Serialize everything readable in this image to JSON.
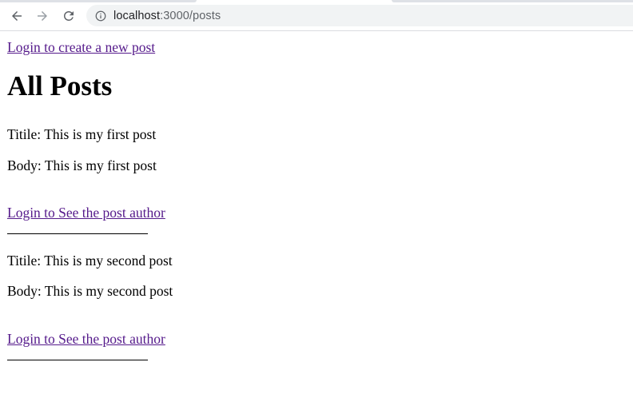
{
  "browser": {
    "url_host": "localhost",
    "url_path": ":3000/posts"
  },
  "page": {
    "create_link": "Login to create a new post",
    "title": "All Posts",
    "posts": [
      {
        "title_line": "Titile: This is my first post",
        "body_line": "Body: This is my first post",
        "author_link": "Login to See the post author"
      },
      {
        "title_line": "Titile: This is my second post",
        "body_line": "Body: This is my second post",
        "author_link": "Login to See the post author"
      }
    ]
  },
  "colors": {
    "visited_link": "#551a8b",
    "omnibox_bg": "#f1f3f4"
  },
  "icons": [
    "back-arrow-icon",
    "forward-arrow-icon",
    "reload-icon",
    "info-icon"
  ]
}
